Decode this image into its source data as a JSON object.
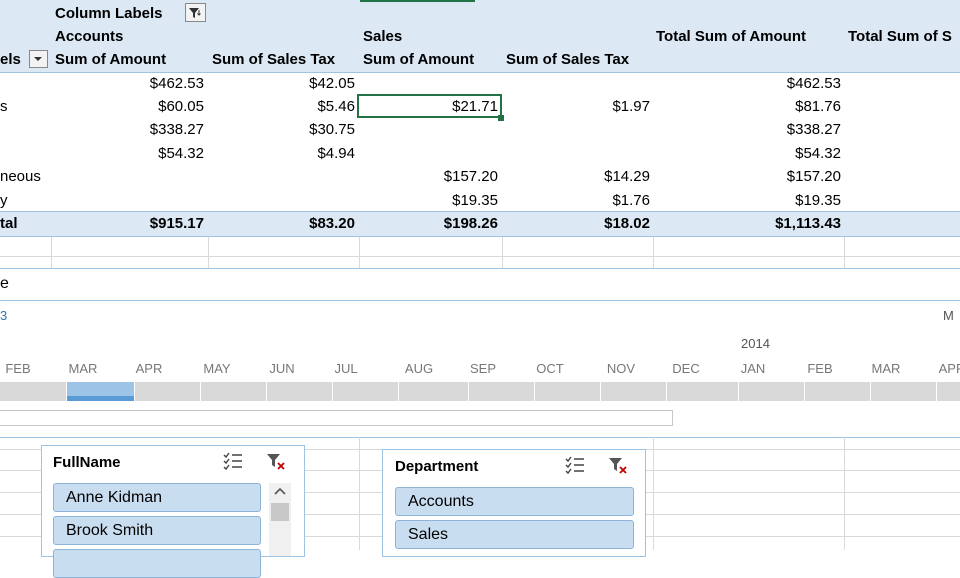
{
  "pivot": {
    "column_labels": "Column Labels",
    "accounts": "Accounts",
    "sales": "Sales",
    "total_sum_amount": "Total Sum of Amount",
    "total_sum_tax": "Total Sum of S",
    "row_labels_fragment": "els",
    "h_sum_amount_1": "Sum of Amount",
    "h_sum_tax_1": "Sum of Sales Tax",
    "h_sum_amount_2": "Sum of Amount",
    "h_sum_tax_2": "Sum of Sales Tax",
    "rows": [
      {
        "label": "",
        "acc_amt": "$462.53",
        "acc_tax": "$42.05",
        "sal_amt": "",
        "sal_tax": "",
        "total": "$462.53"
      },
      {
        "label": "s",
        "acc_amt": "$60.05",
        "acc_tax": "$5.46",
        "sal_amt": "$21.71",
        "sal_tax": "$1.97",
        "total": "$81.76"
      },
      {
        "label": "",
        "acc_amt": "$338.27",
        "acc_tax": "$30.75",
        "sal_amt": "",
        "sal_tax": "",
        "total": "$338.27"
      },
      {
        "label": "",
        "acc_amt": "$54.32",
        "acc_tax": "$4.94",
        "sal_amt": "",
        "sal_tax": "",
        "total": "$54.32"
      },
      {
        "label": "neous",
        "acc_amt": "",
        "acc_tax": "",
        "sal_amt": "$157.20",
        "sal_tax": "$14.29",
        "total": "$157.20"
      },
      {
        "label": "y",
        "acc_amt": "",
        "acc_tax": "",
        "sal_amt": "$19.35",
        "sal_tax": "$1.76",
        "total": "$19.35"
      }
    ],
    "grand": {
      "label": "tal",
      "acc_amt": "$915.17",
      "acc_tax": "$83.20",
      "sal_amt": "$198.26",
      "sal_tax": "$18.02",
      "total": "$1,113.43"
    }
  },
  "timeline": {
    "title_fragment": "e",
    "period_fragment": "3",
    "level_fragment": "M",
    "year_label": "2014",
    "months": [
      "FEB",
      "MAR",
      "APR",
      "MAY",
      "JUN",
      "JUL",
      "AUG",
      "SEP",
      "OCT",
      "NOV",
      "DEC",
      "JAN",
      "FEB",
      "MAR",
      "APR"
    ],
    "selected_month": "MAR"
  },
  "slicers": {
    "fullname": {
      "title": "FullName",
      "items": [
        "Anne Kidman",
        "Brook Smith"
      ]
    },
    "department": {
      "title": "Department",
      "items": [
        "Accounts",
        "Sales"
      ]
    }
  },
  "colors": {
    "header_band": "#dce9f5",
    "selection_border": "#217346",
    "slicer_item": "#c9ddf0"
  }
}
